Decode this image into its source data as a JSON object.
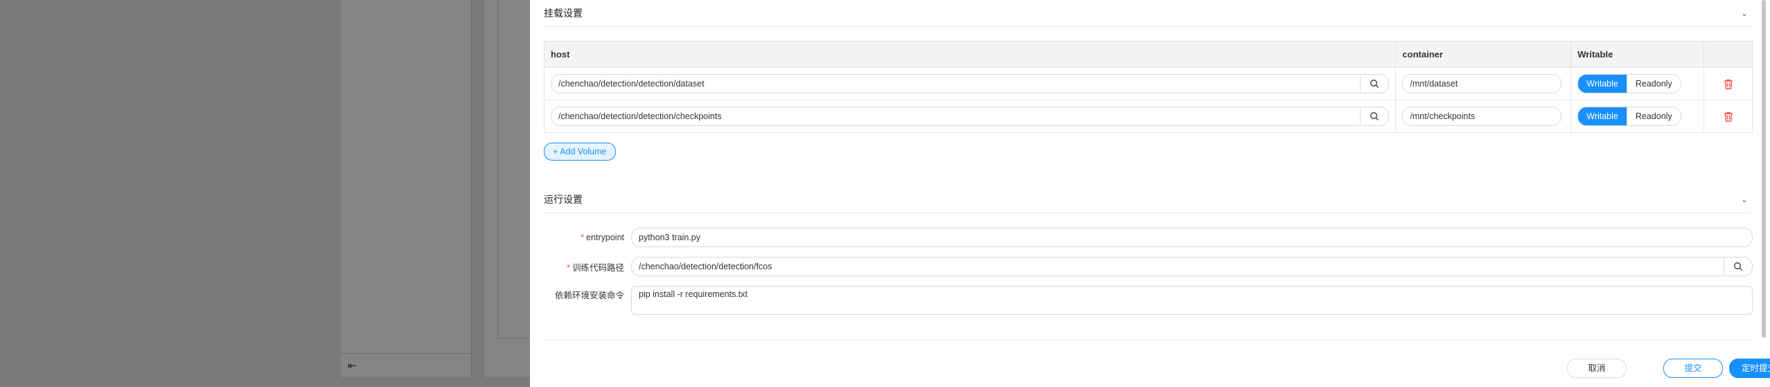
{
  "background": {
    "collapse_icon": "collapse-left-icon"
  },
  "mount_section": {
    "title": "挂载设置",
    "columns": [
      "host",
      "container",
      "Writable"
    ],
    "rows": [
      {
        "host": "/chenchao/detection/detection/dataset",
        "container": "/mnt/dataset",
        "mode_selected": "Writable"
      },
      {
        "host": "/chenchao/detection/detection/checkpoints",
        "container": "/mnt/checkpoints",
        "mode_selected": "Writable"
      }
    ],
    "mode_options": [
      "Writable",
      "Readonly"
    ],
    "add_volume_label": "+ Add Volume"
  },
  "run_section": {
    "title": "运行设置",
    "entrypoint_label": "entrypoint",
    "entrypoint_value": "python3 train.py",
    "code_path_label": "训练代码路径",
    "code_path_value": "/chenchao/detection/detection/fcos",
    "deps_label": "依赖环境安装命令",
    "deps_value": "pip install -r requirements.txt"
  },
  "footer": {
    "cancel_label": "取消",
    "submit_label": "提交",
    "timed_submit_label": "定时提交"
  },
  "colors": {
    "primary": "#1890ff",
    "danger": "#ff4d4f"
  }
}
